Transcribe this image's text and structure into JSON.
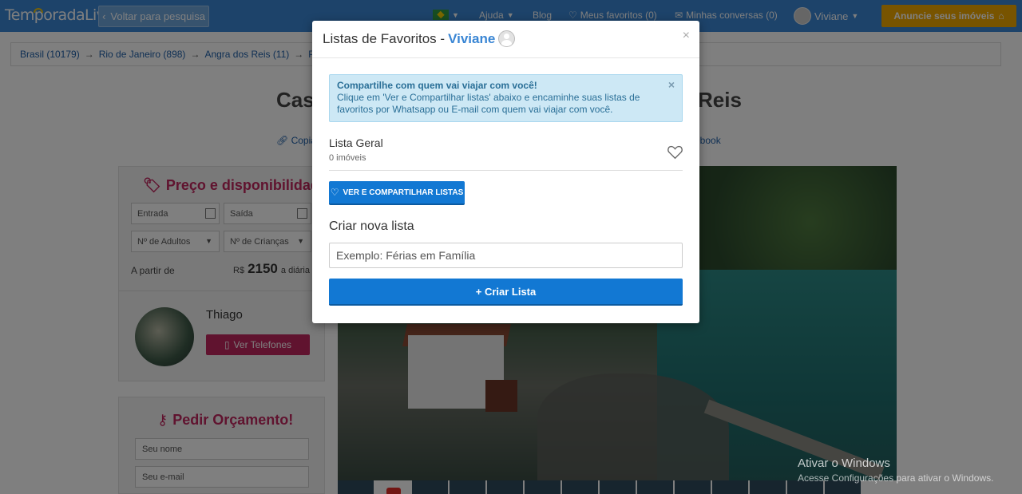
{
  "navbar": {
    "logo_text": "TemporadaLivre",
    "back_label": "Voltar para pesquisa",
    "help_label": "Ajuda",
    "blog_label": "Blog",
    "favorites_label": "Meus favoritos (0)",
    "messages_label": "Minhas conversas (0)",
    "user_name": "Viviane",
    "announce_label": "Anuncie seus imóveis"
  },
  "breadcrumb": {
    "items": [
      "Brasil (10179)",
      "Rio de Janeiro (898)",
      "Angra dos Reis (11)",
      "Por"
    ]
  },
  "listing": {
    "title_left": "Cas",
    "title_right": "Reis",
    "share_left": "Copia",
    "share_right": "ebook"
  },
  "price_panel": {
    "title": "Preço e disponibilidade",
    "checkin_placeholder": "Entrada",
    "checkout_placeholder": "Saída",
    "adults_label": "Nº de Adultos",
    "children_label": "Nº de Crianças",
    "from_label": "A partir de",
    "currency": "R$",
    "price": "2150",
    "per_day": "a diária"
  },
  "host": {
    "name": "Thiago",
    "phone_label": "Ver Telefones"
  },
  "quote_panel": {
    "title": "Pedir Orçamento!",
    "name_placeholder": "Seu nome",
    "email_placeholder": "Seu e-mail"
  },
  "watermark": {
    "line1": "Ativar o Windows",
    "line2": "Acesse Configurações para ativar o Windows."
  },
  "modal": {
    "title": "Listas de Favoritos -",
    "user": "Viviane",
    "alert_title": "Compartilhe com quem vai viajar com você!",
    "alert_body": "Clique em 'Ver e Compartilhar listas' abaixo e encaminhe suas listas de favoritos por Whatsapp ou E-mail com quem vai viajar com você.",
    "list_name": "Lista Geral",
    "list_count": "0 imóveis",
    "share_button": "VER E COMPARTILHAR LISTAS",
    "new_list_title": "Criar nova lista",
    "new_list_placeholder": "Exemplo: Férias em Família",
    "new_list_value": "",
    "create_button": "+ Criar Lista"
  },
  "colors": {
    "navbar": "#3a86d4",
    "accent_pink": "#c0265e",
    "primary_button": "#1278d3",
    "announce_button": "#f0a800"
  }
}
